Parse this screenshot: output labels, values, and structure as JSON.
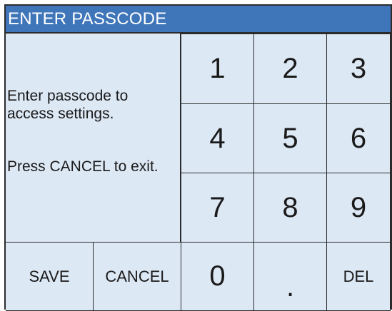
{
  "title": "ENTER PASSCODE",
  "info": {
    "line1": "Enter passcode to access settings.",
    "line2": "Press CANCEL to exit."
  },
  "keypad": {
    "k1": "1",
    "k2": "2",
    "k3": "3",
    "k4": "4",
    "k5": "5",
    "k6": "6",
    "k7": "7",
    "k8": "8",
    "k9": "9",
    "k0": "0",
    "dot": ".",
    "del": "DEL"
  },
  "actions": {
    "save": "SAVE",
    "cancel": "CANCEL"
  },
  "colors": {
    "title_bar": "#3f76b9",
    "panel_bg": "#dde8f5",
    "border": "#2b2b2b"
  }
}
